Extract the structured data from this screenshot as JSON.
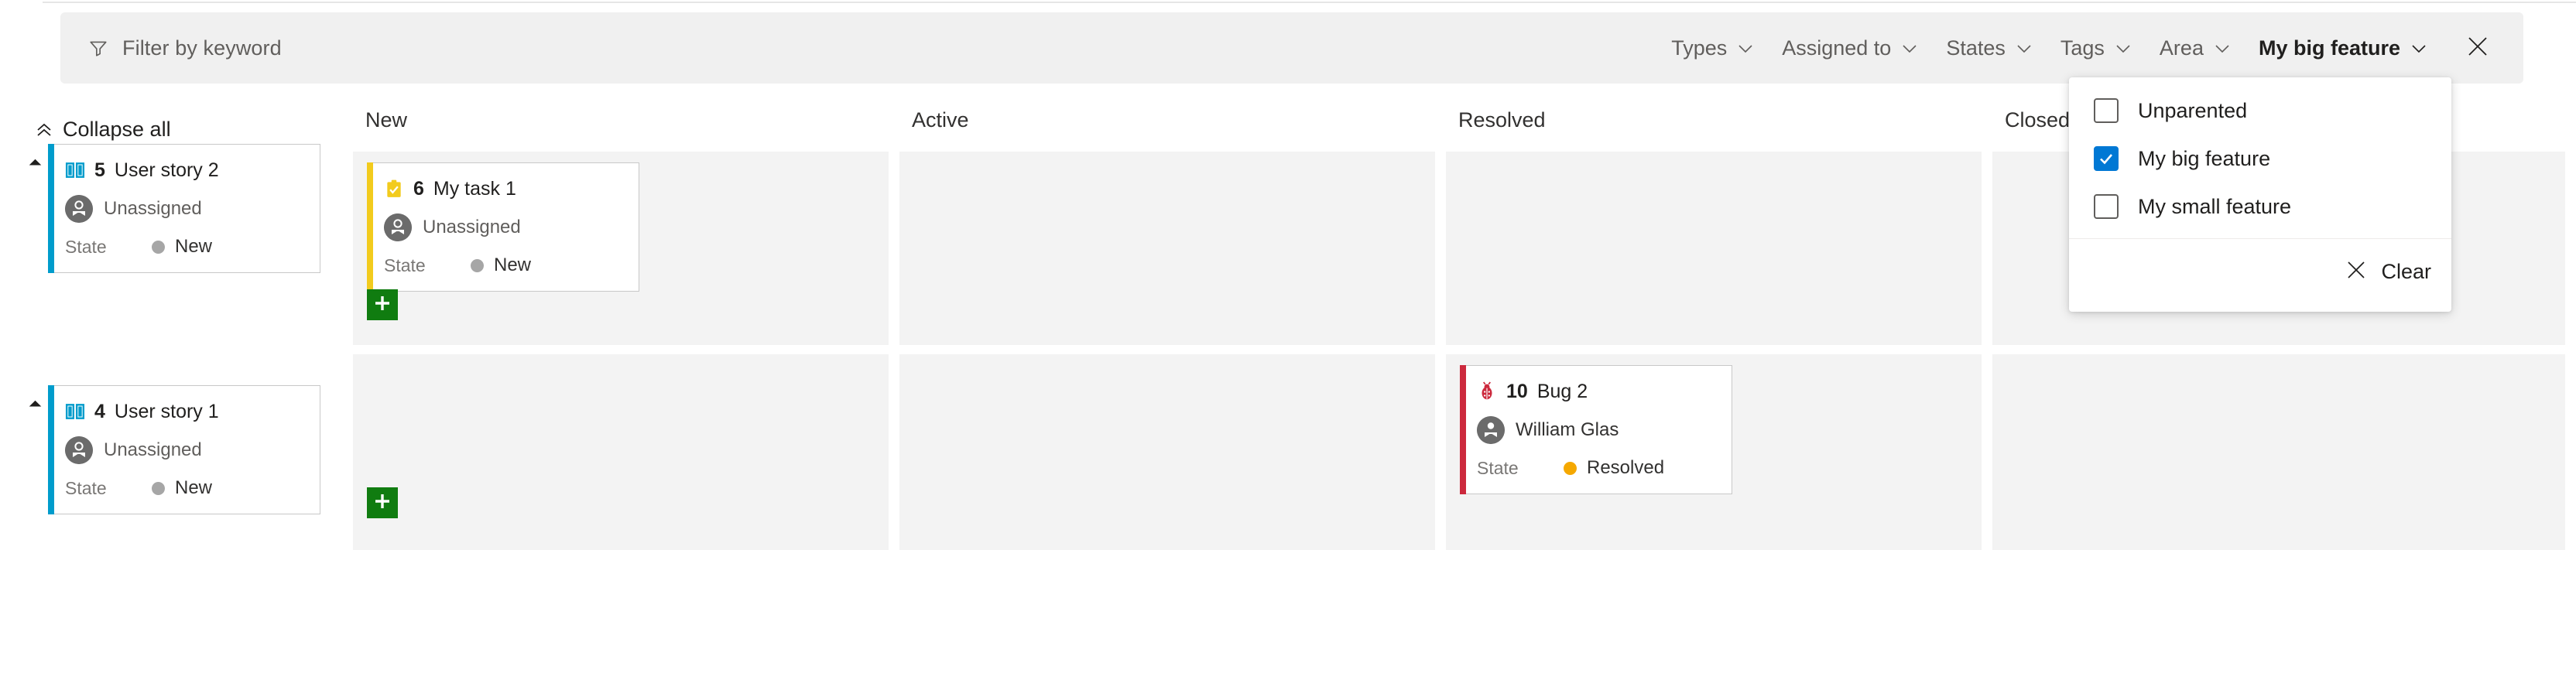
{
  "filter_bar": {
    "keyword_placeholder": "Filter by keyword",
    "funnel_icon": "funnel-icon",
    "close_icon": "close-icon",
    "pills": [
      {
        "label": "Types",
        "selected": false
      },
      {
        "label": "Assigned to",
        "selected": false
      },
      {
        "label": "States",
        "selected": false
      },
      {
        "label": "Tags",
        "selected": false
      },
      {
        "label": "Area",
        "selected": false
      },
      {
        "label": "My big feature",
        "selected": true
      }
    ]
  },
  "collapse_all": {
    "label": "Collapse all",
    "icon": "double-chevron-up-icon"
  },
  "board": {
    "columns": [
      "New",
      "Active",
      "Resolved",
      "Closed"
    ],
    "add_button_icon": "plus-icon"
  },
  "backlog": [
    {
      "id": "5",
      "title": "User story 2",
      "type_icon": "user-story-icon",
      "accent": "#009ccc",
      "assignee": "Unassigned",
      "state_label": "State",
      "state_value": "New",
      "state_color": "#a6a6a6"
    },
    {
      "id": "4",
      "title": "User story 1",
      "type_icon": "user-story-icon",
      "accent": "#009ccc",
      "assignee": "Unassigned",
      "state_label": "State",
      "state_value": "New",
      "state_color": "#a6a6a6"
    }
  ],
  "cards": {
    "task1": {
      "id": "6",
      "title": "My task 1",
      "type_icon": "task-icon",
      "accent": "#f2cb1d",
      "assignee": "Unassigned",
      "state_label": "State",
      "state_value": "New",
      "state_color": "#a6a6a6"
    },
    "bug2": {
      "id": "10",
      "title": "Bug 2",
      "type_icon": "bug-icon",
      "accent": "#cc293d",
      "assignee": "William Glas",
      "state_label": "State",
      "state_value": "Resolved",
      "state_color": "#f5a800"
    }
  },
  "dropdown": {
    "options": [
      {
        "label": "Unparented",
        "checked": false
      },
      {
        "label": "My big feature",
        "checked": true
      },
      {
        "label": "My small feature",
        "checked": false
      }
    ],
    "clear_label": "Clear",
    "clear_icon": "close-icon"
  },
  "colors": {
    "accent_blue": "#009ccc",
    "accent_yellow": "#f2cb1d",
    "accent_red": "#cc293d",
    "checkbox_blue": "#0078d4",
    "add_green": "#107c10",
    "state_new": "#a6a6a6",
    "state_resolved": "#f5a800"
  }
}
